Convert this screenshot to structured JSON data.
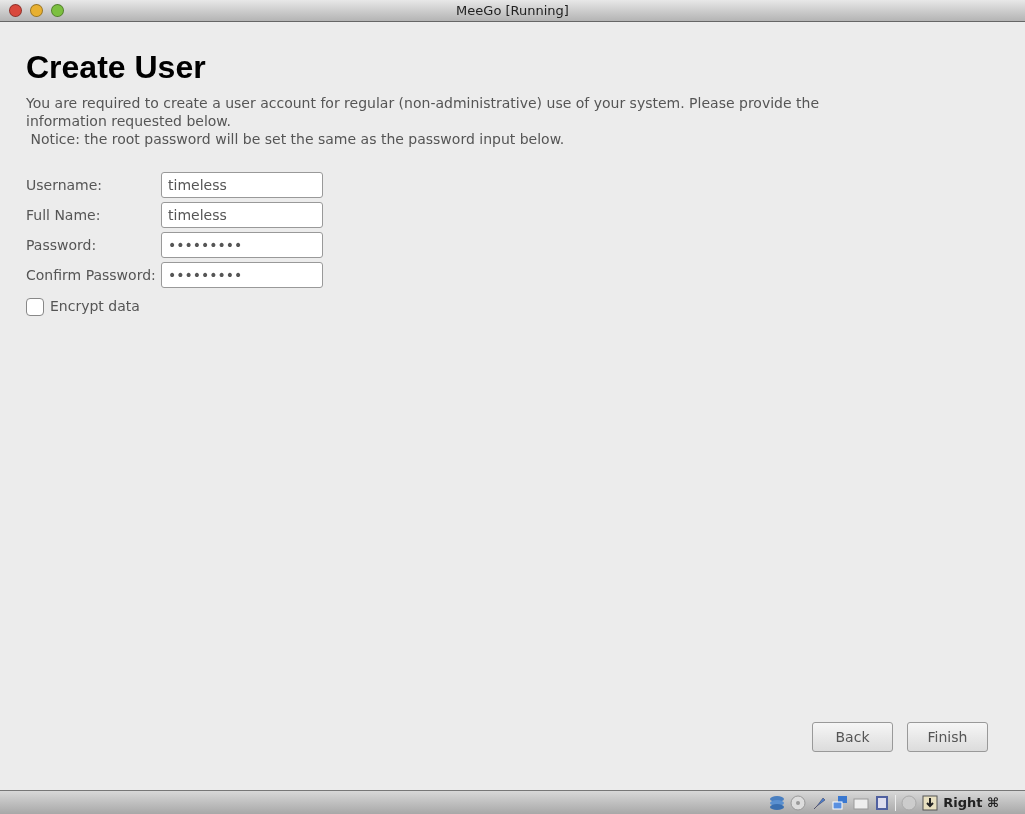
{
  "window": {
    "title": "MeeGo [Running]"
  },
  "page": {
    "heading": "Create User",
    "description": "You are required to create a user account for regular (non-administrative) use of your system. Please provide the information requested below.",
    "notice": " Notice: the root password will be set the same as the password input below."
  },
  "fields": [
    {
      "label": "Username:",
      "value": "timeless"
    },
    {
      "label": "Full Name:",
      "value": "timeless"
    },
    {
      "label": "Password:",
      "value": "•••••••••"
    },
    {
      "label": "Confirm Password:",
      "value": "•••••••••"
    }
  ],
  "encrypt": {
    "label": "Encrypt data",
    "checked": false
  },
  "buttons": [
    {
      "label": "Back"
    },
    {
      "label": "Finish"
    }
  ],
  "status_bar": {
    "host_key": "Right ⌘"
  }
}
